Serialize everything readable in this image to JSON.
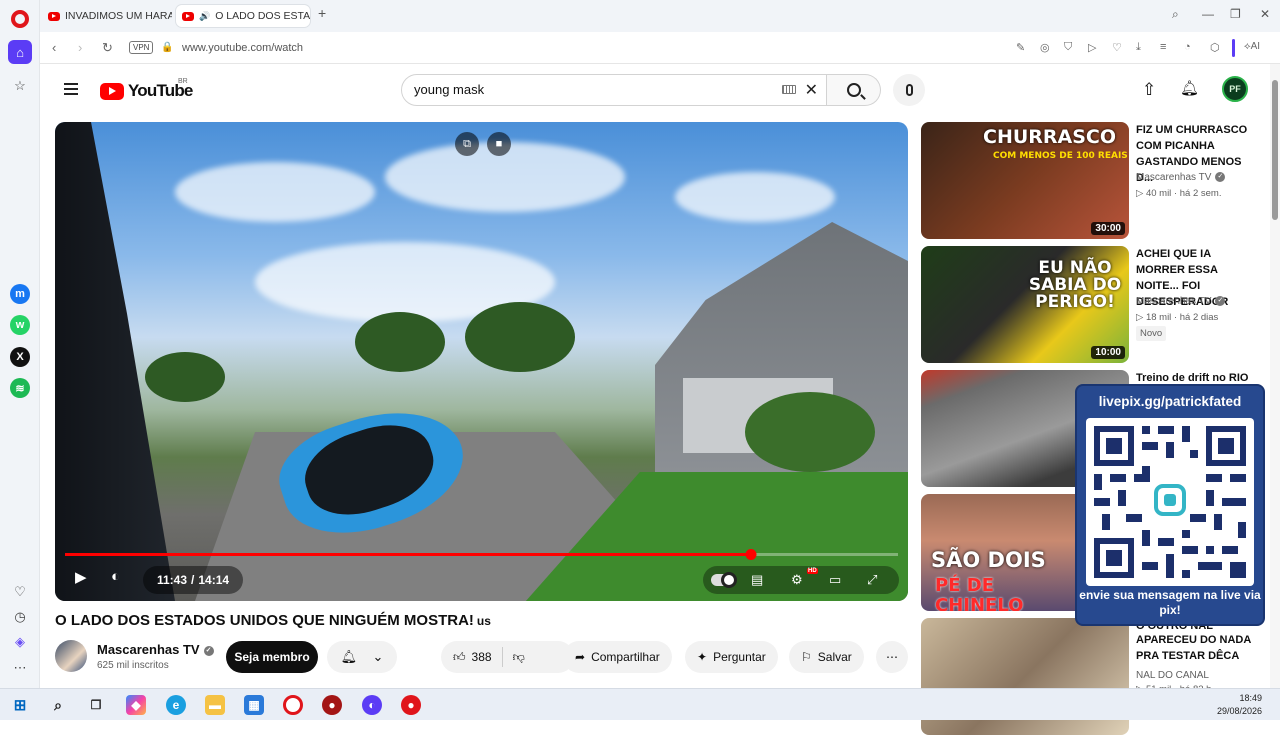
{
  "browser": {
    "tabs": [
      {
        "label": "INVADIMOS UM HARAS I"
      },
      {
        "label": "O LADO DOS ESTADO"
      }
    ],
    "vpn_label": "VPN",
    "url": "www.youtube.com/watch",
    "ai_label": "AI"
  },
  "youtube": {
    "logo_text": "YouTube",
    "region": "BR",
    "search_value": "young mask",
    "avatar_initials": "PF"
  },
  "player": {
    "current_time": "11:43",
    "total_time": "14:14",
    "progress": 0.824
  },
  "video": {
    "title": "O LADO DOS ESTADOS UNIDOS QUE NINGUÉM MOSTRA!",
    "flag": "us",
    "channel": "Mascarenhas TV",
    "subscribers": "625 mil inscritos",
    "member_label": "Seja membro",
    "likes": "388",
    "share_label": "Compartilhar",
    "ask_label": "Perguntar",
    "save_label": "Salvar"
  },
  "recommendations": [
    {
      "title": "FIZ UM CHURRASCO COM PICANHA GASTANDO MENOS D...",
      "channel": "Mascarenhas TV",
      "views": "40 mil",
      "age": "há 2 sem.",
      "duration": "30:00",
      "thumb_text": "CHURRASCO",
      "thumb_sub": "COM MENOS DE 100 REAIS"
    },
    {
      "title": "ACHEI QUE IA MORRER ESSA NOITE... FOI DESESPERADOR",
      "channel": "Mascarenhas TV",
      "views": "18 mil",
      "age": "há 2 dias",
      "duration": "10:00",
      "badge": "Novo",
      "thumb_text": "EU NÃO SABIA DO PERIGO!"
    },
    {
      "title": "Treino de drift no RIO"
    },
    {
      "thumb_text": "SÃO DOIS",
      "thumb_sub": "PÉ DE CHINELO"
    },
    {
      "title": "APARECEU DO NADA PRA TESTAR DÊCA",
      "title_partial": "O OUTRO NÃL",
      "channel": "NAL DO CANAL",
      "views": "51 mil",
      "age": "há 82 h"
    }
  ],
  "qr_overlay": {
    "title": "livepix.gg/patrickfated",
    "caption": "envie sua mensagem na live via pix!"
  },
  "taskbar": {
    "time": "18:49",
    "date": "29/08/2026"
  }
}
